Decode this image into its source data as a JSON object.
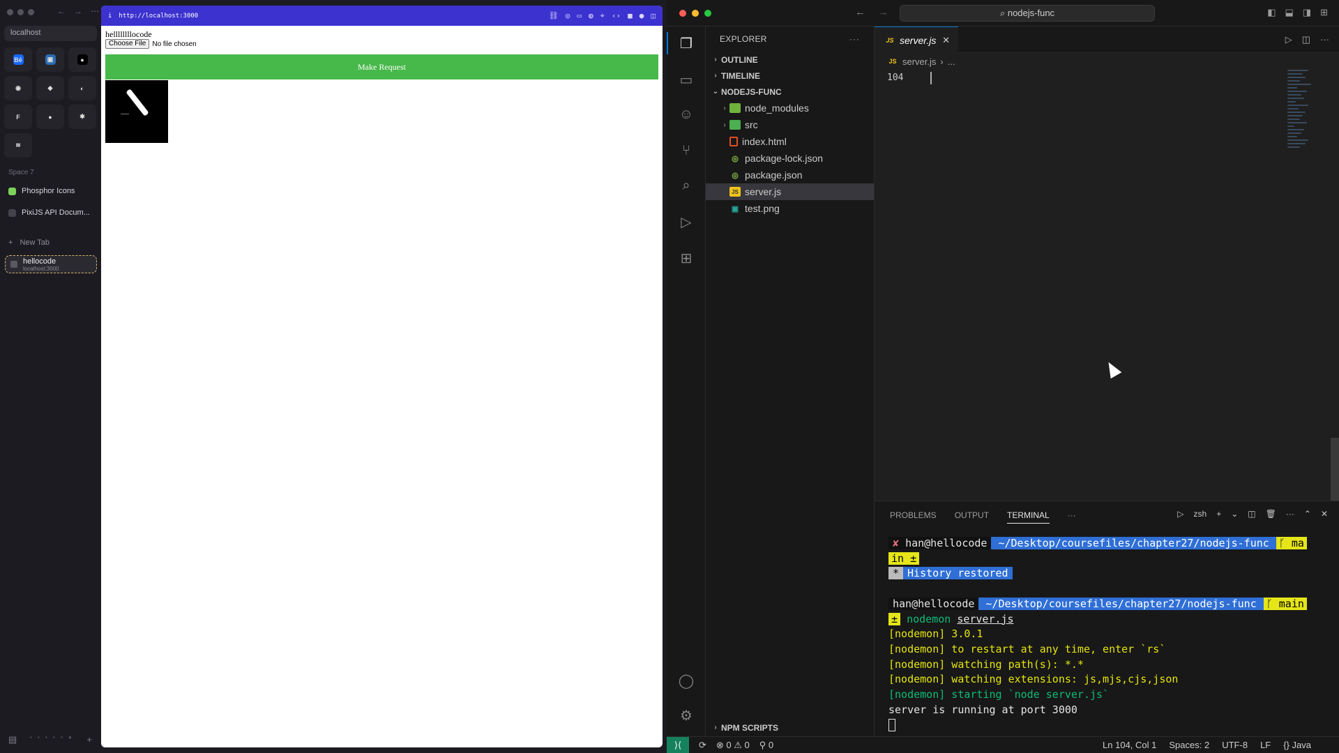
{
  "arc": {
    "address": "localhost",
    "space_label": "Space 7",
    "pinned": [
      {
        "label": "Phosphor Icons",
        "color": "#7dd35a"
      },
      {
        "label": "PixiJS API Docum...",
        "color": "#444"
      }
    ],
    "new_tab": "New Tab",
    "active_tab": {
      "title": "hellocode",
      "subtitle": "localhost:3000"
    },
    "favorites": [
      {
        "icon": "behance-icon",
        "glyph": "Bē",
        "bg": "#1769ff"
      },
      {
        "icon": "calendar-icon",
        "glyph": "▣",
        "bg": "#2b6cb0"
      },
      {
        "icon": "circle-app-icon",
        "glyph": "●",
        "bg": "#000"
      },
      {
        "icon": "github-icon",
        "glyph": "◉",
        "bg": "#25242b"
      },
      {
        "icon": "figma-icon",
        "glyph": "◆",
        "bg": "#25242b"
      },
      {
        "icon": "app-icon",
        "glyph": "◐",
        "bg": "#25242b"
      },
      {
        "icon": "framer-icon",
        "glyph": "F",
        "bg": "#25242b"
      },
      {
        "icon": "gradient-icon",
        "glyph": "●",
        "bg": "#25242b"
      },
      {
        "icon": "openai-icon",
        "glyph": "✱",
        "bg": "#25242b"
      },
      {
        "icon": "misc-icon",
        "glyph": "≋",
        "bg": "#25242b"
      }
    ]
  },
  "page": {
    "url": "http://localhost:3000",
    "heading": "hellllllllocode",
    "choose_file": "Choose File",
    "no_file": "No file chosen",
    "make_request": "Make Request"
  },
  "vscode": {
    "search": "nodejs-func",
    "explorer_title": "EXPLORER",
    "sections": {
      "outline": "OUTLINE",
      "timeline": "TIMELINE",
      "project": "NODEJS-FUNC",
      "npm": "NPM SCRIPTS"
    },
    "tree": [
      {
        "label": "node_modules",
        "type": "folder"
      },
      {
        "label": "src",
        "type": "folder"
      },
      {
        "label": "index.html",
        "type": "html"
      },
      {
        "label": "package-lock.json",
        "type": "json"
      },
      {
        "label": "package.json",
        "type": "json"
      },
      {
        "label": "server.js",
        "type": "js"
      },
      {
        "label": "test.png",
        "type": "image"
      }
    ],
    "tab": "server.js",
    "breadcrumb_file": "server.js",
    "breadcrumb_more": "...",
    "line_number": "104",
    "panel_tabs": [
      "PROBLEMS",
      "OUTPUT",
      "TERMINAL"
    ],
    "shell": "zsh",
    "terminal": {
      "user": "han@hellocode",
      "path": "~/Desktop/coursefiles/chapter27/nodejs-func",
      "branch1": "ma",
      "branch1_wrap": "in ±",
      "history": "History restored",
      "branch2": "main",
      "cmd": "nodemon",
      "arg": "server.js",
      "lines": [
        "[nodemon] 3.0.1",
        "[nodemon] to restart at any time, enter `rs`",
        "[nodemon] watching path(s): *.*",
        "[nodemon] watching extensions: js,mjs,cjs,json"
      ],
      "starting": "[nodemon] starting `node server.js`",
      "server": "server is running at port 3000"
    },
    "status": {
      "errors": "0",
      "warnings": "0",
      "ports": "0",
      "position": "Ln 104, Col 1",
      "spaces": "Spaces: 2",
      "encoding": "UTF-8",
      "eol": "LF",
      "language": "Java"
    }
  }
}
